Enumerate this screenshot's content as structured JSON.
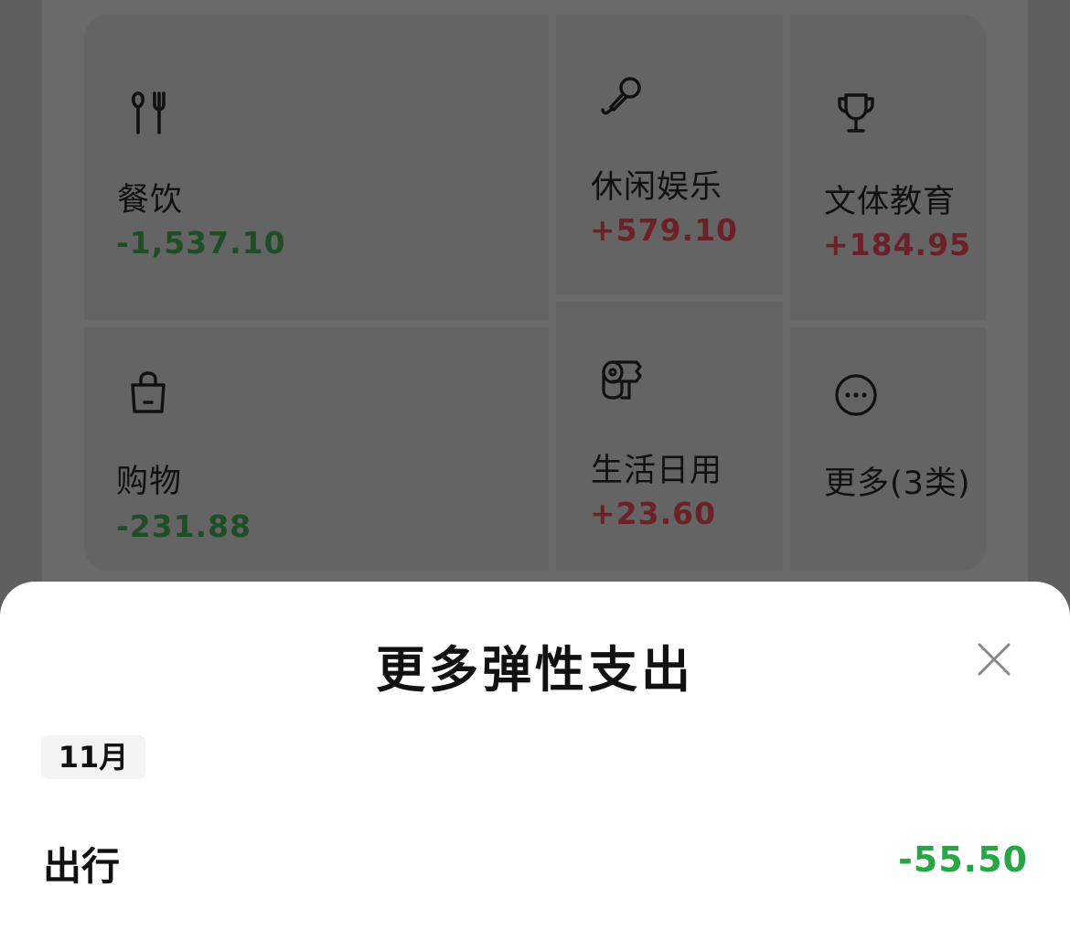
{
  "background": {
    "categories": [
      {
        "id": "dining",
        "icon": "fork-knife-icon",
        "name": "餐饮",
        "amount": "-1,537.10",
        "amount_color": "#1e4d26"
      },
      {
        "id": "leisure",
        "icon": "microphone-icon",
        "name": "休闲娱乐",
        "amount": "+579.10",
        "amount_color": "#6b2127"
      },
      {
        "id": "education",
        "icon": "trophy-icon",
        "name": "文体教育",
        "amount": "+184.95",
        "amount_color": "#6b2127"
      },
      {
        "id": "shopping",
        "icon": "shopping-bag-icon",
        "name": "购物",
        "amount": "-231.88",
        "amount_color": "#1e4d26"
      },
      {
        "id": "daily",
        "icon": "tissue-roll-icon",
        "name": "生活日用",
        "amount": "+23.60",
        "amount_color": "#6b2127"
      },
      {
        "id": "more",
        "icon": "more-dots-icon",
        "name": "更多(3类)"
      }
    ]
  },
  "sheet": {
    "title": "更多弹性支出",
    "close_icon": "close-icon",
    "month": "11月",
    "rows": [
      {
        "label": "出行",
        "amount": "-55.50",
        "amount_color": "#27a645"
      }
    ]
  },
  "colors": {
    "overlay_bg": "#5f5f5f",
    "sheet_bg": "#ffffff",
    "positive_dimmed": "#6b2127",
    "negative_dimmed": "#1e4d26",
    "negative": "#27a645"
  }
}
